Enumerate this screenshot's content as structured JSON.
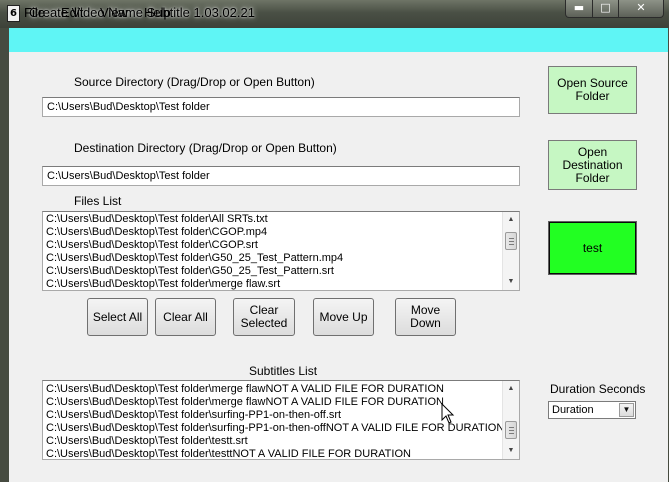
{
  "window": {
    "title": "Create Video Name Subtitle 1.03.02.21",
    "app_icon_glyph": "6"
  },
  "window_controls": {
    "minimize": "▬",
    "maximize": "□",
    "close": "✕"
  },
  "menu": [
    "File",
    "Edit",
    "View",
    "Help"
  ],
  "source": {
    "label": "Source Directory (Drag/Drop or Open Button)",
    "value": "C:\\Users\\Bud\\Desktop\\Test folder"
  },
  "destination": {
    "label": "Destination Directory (Drag/Drop or Open Button)",
    "value": "C:\\Users\\Bud\\Desktop\\Test folder"
  },
  "files": {
    "label": "Files List",
    "items": [
      "C:\\Users\\Bud\\Desktop\\Test folder\\All SRTs.txt",
      "C:\\Users\\Bud\\Desktop\\Test folder\\CGOP.mp4",
      "C:\\Users\\Bud\\Desktop\\Test folder\\CGOP.srt",
      "C:\\Users\\Bud\\Desktop\\Test folder\\G50_25_Test_Pattern.mp4",
      "C:\\Users\\Bud\\Desktop\\Test folder\\G50_25_Test_Pattern.srt",
      "C:\\Users\\Bud\\Desktop\\Test folder\\merge flaw.srt"
    ]
  },
  "buttons": {
    "open_source": "Open Source Folder",
    "open_destination": "Open Destination Folder",
    "test": "test",
    "select_all": "Select All",
    "clear_all": "Clear All",
    "clear_selected": "Clear Selected",
    "move_up": "Move Up",
    "move_down": "Move Down"
  },
  "subtitles": {
    "label": "Subtitles List",
    "items": [
      "C:\\Users\\Bud\\Desktop\\Test folder\\merge flawNOT A VALID FILE FOR DURATION",
      "C:\\Users\\Bud\\Desktop\\Test folder\\merge flawNOT A VALID FILE FOR DURATION",
      "C:\\Users\\Bud\\Desktop\\Test folder\\surfing-PP1-on-then-off.srt",
      "C:\\Users\\Bud\\Desktop\\Test folder\\surfing-PP1-on-then-offNOT A VALID FILE FOR DURATION",
      "C:\\Users\\Bud\\Desktop\\Test folder\\testt.srt",
      "C:\\Users\\Bud\\Desktop\\Test folder\\testtNOT A VALID FILE FOR DURATION"
    ]
  },
  "duration": {
    "label": "Duration Seconds",
    "selected": "Duration"
  },
  "colors": {
    "menubar": "#5ff5f5",
    "open_buttons": "#c6f7c3",
    "test_button": "#22ff22"
  },
  "icons": {
    "scroll_up": "▲",
    "scroll_down": "▼",
    "dropdown": "▼"
  }
}
